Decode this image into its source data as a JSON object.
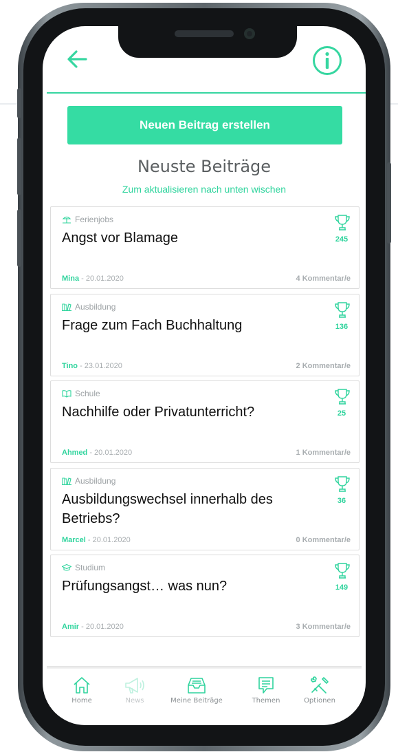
{
  "header": {
    "back_icon": "arrow-left-icon",
    "info_icon": "info-circle-icon"
  },
  "cta_label": "Neuen Beitrag erstellen",
  "title": "Neuste Beiträge",
  "subtitle": "Zum aktualisieren nach unten wischen",
  "colors": {
    "accent": "#35dca3",
    "text_accent": "#2fd49d"
  },
  "posts": [
    {
      "category": "Ferienjobs",
      "category_icon": "beach-icon",
      "title": "Angst vor Blamage",
      "score": "245",
      "author": "Mina",
      "date": " - 20.01.2020",
      "comments": "4 Kommentar/e"
    },
    {
      "category": "Ausbildung",
      "category_icon": "books-icon",
      "title": "Frage zum Fach Buchhaltung",
      "score": "136",
      "author": "Tino",
      "date": " - 23.01.2020",
      "comments": "2 Kommentar/e"
    },
    {
      "category": "Schule",
      "category_icon": "open-book-icon",
      "title": "Nachhilfe oder Privatunterricht?",
      "score": "25",
      "author": "Ahmed",
      "date": " - 20.01.2020",
      "comments": "1 Kommentar/e"
    },
    {
      "category": "Ausbildung",
      "category_icon": "books-icon",
      "title": "Ausbildungswechsel innerhalb des Betriebs?",
      "score": "36",
      "author": "Marcel",
      "date": " - 20.01.2020",
      "comments": "0 Kommentar/e"
    },
    {
      "category": "Studium",
      "category_icon": "graduation-cap-icon",
      "title": "Prüfungsangst… was nun?",
      "score": "149",
      "author": "Amir",
      "date": " - 20.01.2020",
      "comments": "3 Kommentar/e"
    }
  ],
  "tabs": [
    {
      "label": "Home",
      "icon": "home-icon"
    },
    {
      "label": "News",
      "icon": "megaphone-icon"
    },
    {
      "label": "Meine Beiträge",
      "icon": "inbox-tray-icon"
    },
    {
      "label": "Themen",
      "icon": "chat-bubble-icon"
    },
    {
      "label": "Optionen",
      "icon": "tools-icon"
    }
  ]
}
